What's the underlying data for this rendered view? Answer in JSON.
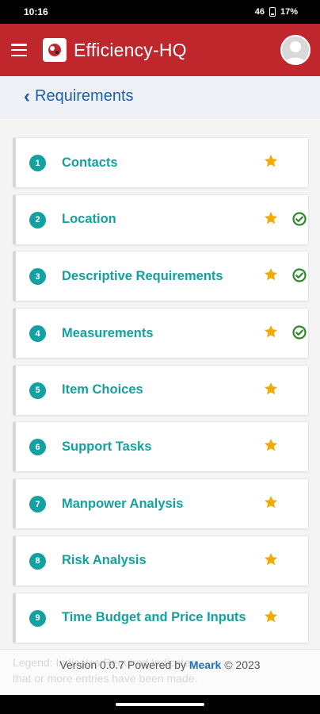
{
  "status_bar": {
    "time": "10:16",
    "network": "46",
    "battery": "17%"
  },
  "app_bar": {
    "title": "Efficiency-HQ"
  },
  "page": {
    "back_label": "Requirements"
  },
  "colors": {
    "brand_red": "#c0272d",
    "teal": "#14a0a0",
    "star": "#f2a900",
    "check": "#2e8b2e",
    "link_blue": "#1f5fa8"
  },
  "requirements": [
    {
      "number": "1",
      "label": "Contacts",
      "starred": true,
      "complete": false
    },
    {
      "number": "2",
      "label": "Location",
      "starred": true,
      "complete": true
    },
    {
      "number": "3",
      "label": "Descriptive Requirements",
      "starred": true,
      "complete": true
    },
    {
      "number": "4",
      "label": "Measurements",
      "starred": true,
      "complete": true
    },
    {
      "number": "5",
      "label": "Item Choices",
      "starred": true,
      "complete": false
    },
    {
      "number": "6",
      "label": "Support Tasks",
      "starred": true,
      "complete": false
    },
    {
      "number": "7",
      "label": "Manpower Analysis",
      "starred": true,
      "complete": false
    },
    {
      "number": "8",
      "label": "Risk Analysis",
      "starred": true,
      "complete": false
    },
    {
      "number": "9",
      "label": "Time Budget and Price Inputs",
      "starred": true,
      "complete": false
    }
  ],
  "footer": {
    "legend_line1": "Legend:",
    "legend_line1b": "Indicates Required",
    "legend_line1c": "Indicates",
    "legend_line2": "that or more entries have been made.",
    "version_prefix": "Version 0.0.7 Powered by",
    "brand": "Meark",
    "copyright": "© 2023"
  }
}
